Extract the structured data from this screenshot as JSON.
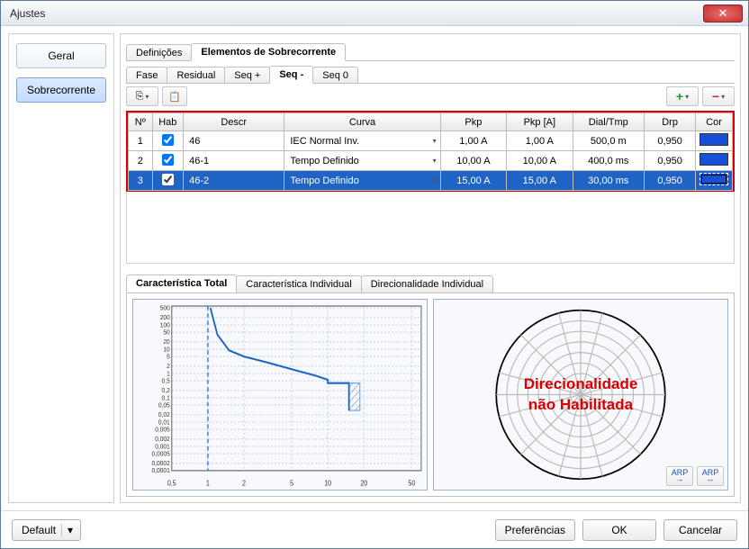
{
  "window": {
    "title": "Ajustes"
  },
  "sidebar": {
    "items": [
      {
        "label": "Geral"
      },
      {
        "label": "Sobrecorrente"
      }
    ],
    "active_index": 1
  },
  "tabs_main": {
    "items": [
      {
        "label": "Definições"
      },
      {
        "label": "Elementos de Sobrecorrente"
      }
    ],
    "active_index": 1
  },
  "tabs_sub": {
    "items": [
      {
        "label": "Fase"
      },
      {
        "label": "Residual"
      },
      {
        "label": "Seq +"
      },
      {
        "label": "Seq -"
      },
      {
        "label": "Seq 0"
      }
    ],
    "active_index": 3
  },
  "table": {
    "headers": [
      "Nº",
      "Hab",
      "Descr",
      "Curva",
      "Pkp",
      "Pkp [A]",
      "Dial/Tmp",
      "Drp",
      "Cor"
    ],
    "rows": [
      {
        "num": "1",
        "hab": true,
        "descr": "46",
        "curva": "IEC Normal Inv.",
        "pkp": "1,00 A",
        "pkpA": "1,00 A",
        "dial": "500,0 m",
        "drp": "0,950",
        "cor": "#1650d8",
        "selected": false
      },
      {
        "num": "2",
        "hab": true,
        "descr": "46-1",
        "curva": "Tempo Definido",
        "pkp": "10,00 A",
        "pkpA": "10,00 A",
        "dial": "400,0 ms",
        "drp": "0,950",
        "cor": "#1650d8",
        "selected": false
      },
      {
        "num": "3",
        "hab": true,
        "descr": "46-2",
        "curva": "Tempo Definido",
        "pkp": "15,00 A",
        "pkpA": "15,00 A",
        "dial": "30,00 ms",
        "drp": "0,950",
        "cor": "#1650d8",
        "selected": true
      }
    ]
  },
  "char_tabs": {
    "items": [
      {
        "label": "Característica Total"
      },
      {
        "label": "Característica Individual"
      },
      {
        "label": "Direcionalidade Individual"
      }
    ],
    "active_index": 0
  },
  "polar": {
    "message_line1": "Direcionalidade",
    "message_line2": "não Habilitada",
    "btn1": "ARP",
    "btn2": "ARP"
  },
  "footer": {
    "default": "Default",
    "prefs": "Preferências",
    "ok": "OK",
    "cancel": "Cancelar"
  },
  "chart_data": {
    "type": "line",
    "xscale": "log",
    "yscale": "log",
    "xlabel": "",
    "ylabel": "",
    "xlim": [
      0.5,
      60
    ],
    "ylim": [
      0.0001,
      600
    ],
    "x_ticks": [
      0.5,
      1.0,
      2.0,
      5.0,
      10,
      20,
      50
    ],
    "y_ticks": [
      500,
      200,
      100,
      50,
      20,
      10,
      5.0,
      2.0,
      1.0,
      0.5,
      0.2,
      0.1,
      0.05,
      0.02,
      0.01,
      0.005,
      0.002,
      0.001,
      0.0005,
      0.0002,
      0.0001
    ],
    "vertical_dashed_at": 1.0,
    "series": [
      {
        "name": "Característica Total",
        "color": "#1f63c4",
        "points": [
          {
            "x": 1.05,
            "y": 500
          },
          {
            "x": 1.2,
            "y": 40
          },
          {
            "x": 1.5,
            "y": 9
          },
          {
            "x": 2.0,
            "y": 5
          },
          {
            "x": 3.0,
            "y": 3
          },
          {
            "x": 5.0,
            "y": 1.5
          },
          {
            "x": 8.0,
            "y": 0.8
          },
          {
            "x": 10.0,
            "y": 0.55
          },
          {
            "x": 10.0,
            "y": 0.4
          },
          {
            "x": 15.0,
            "y": 0.4
          },
          {
            "x": 15.0,
            "y": 0.03
          }
        ]
      }
    ],
    "hatched_region": {
      "x0": 15.0,
      "x1": 18.5,
      "y0": 0.03,
      "y1": 0.4
    }
  }
}
